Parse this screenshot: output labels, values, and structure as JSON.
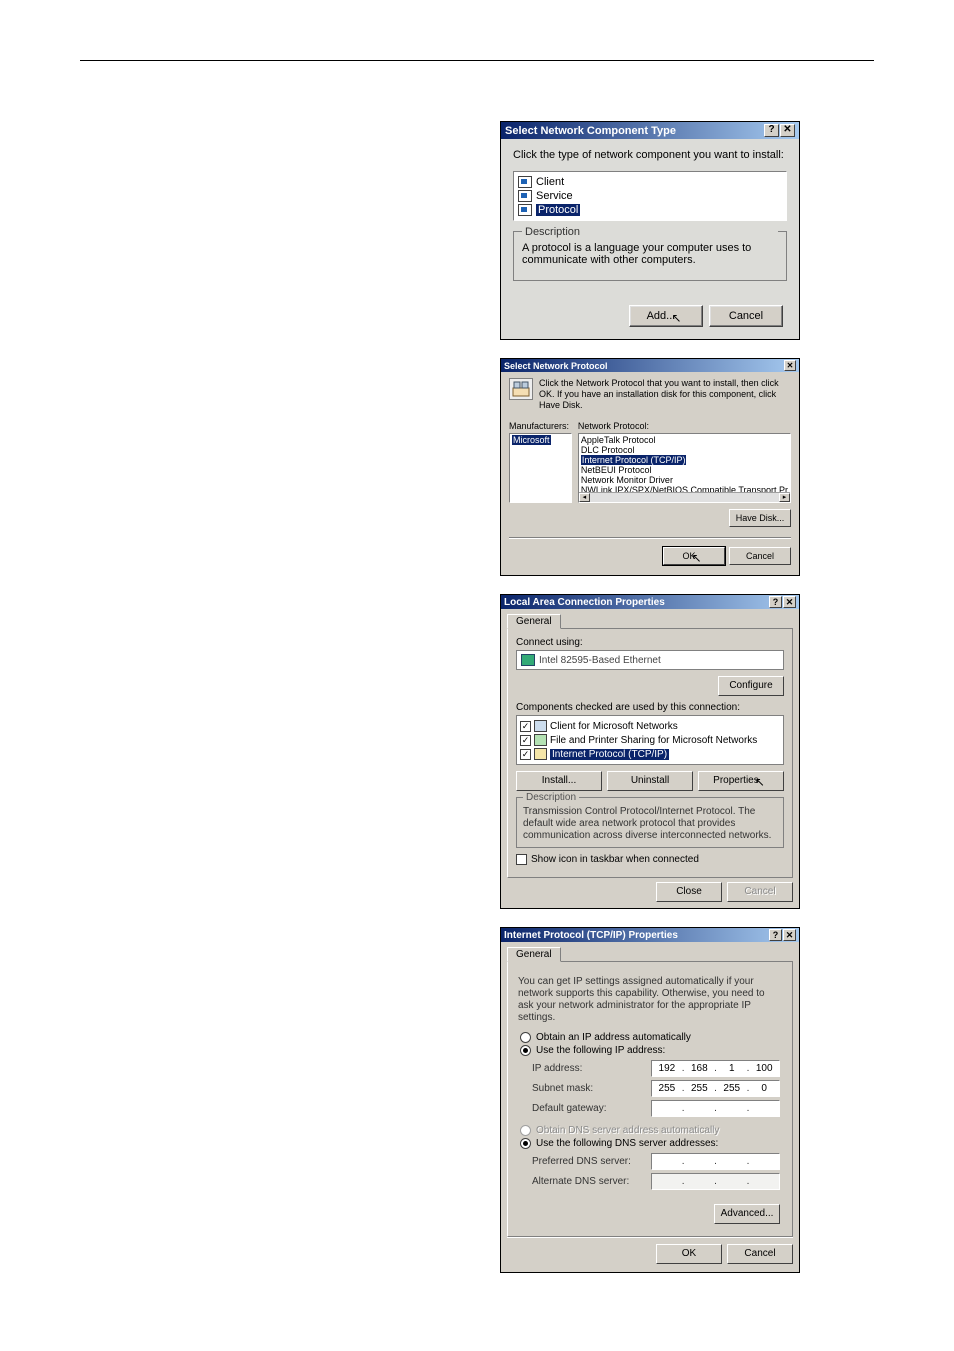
{
  "dlg1": {
    "title": "Select Network Component Type",
    "instruction": "Click the type of network component you want to install:",
    "items": {
      "client": "Client",
      "service": "Service",
      "protocol": "Protocol"
    },
    "desc_label": "Description",
    "desc_text": "A protocol is a language your computer uses to communicate with other computers.",
    "add": "Add...",
    "cancel": "Cancel"
  },
  "dlg2": {
    "title": "Select Network Protocol",
    "instruction": "Click the Network Protocol that you want to install, then click OK. If you have an installation disk for this component, click Have Disk.",
    "mfr_label": "Manufacturers:",
    "mfr_item": "Microsoft",
    "proto_label": "Network Protocol:",
    "protocols": {
      "p0": "AppleTalk Protocol",
      "p1": "DLC Protocol",
      "p2": "Internet Protocol (TCP/IP)",
      "p3": "NetBEUI Protocol",
      "p4": "Network Monitor Driver",
      "p5": "NWLink IPX/SPX/NetBIOS Compatible Transport Pr"
    },
    "have_disk": "Have Disk...",
    "ok": "OK",
    "cancel": "Cancel"
  },
  "dlg3": {
    "title": "Local Area Connection Properties",
    "tab": "General",
    "connect_label": "Connect using:",
    "adapter": "Intel 82595-Based Ethernet",
    "configure": "Configure",
    "components_label": "Components checked are used by this connection:",
    "c0": "Client for Microsoft Networks",
    "c1": "File and Printer Sharing for Microsoft Networks",
    "c2": "Internet Protocol (TCP/IP)",
    "install": "Install...",
    "uninstall": "Uninstall",
    "properties": "Properties",
    "desc_label": "Description",
    "desc_text": "Transmission Control Protocol/Internet Protocol. The default wide area network protocol that provides communication across diverse interconnected networks.",
    "show_icon": "Show icon in taskbar when connected",
    "close": "Close",
    "cancel": "Cancel"
  },
  "dlg4": {
    "title": "Internet Protocol (TCP/IP) Properties",
    "tab": "General",
    "intro": "You can get IP settings assigned automatically if your network supports this capability. Otherwise, you need to ask your network administrator for the appropriate IP settings.",
    "obtain_ip": "Obtain an IP address automatically",
    "use_ip": "Use the following IP address:",
    "ip_label": "IP address:",
    "ip_v": {
      "a": "192",
      "b": "168",
      "c": "1",
      "d": "100"
    },
    "mask_label": "Subnet mask:",
    "mask_v": {
      "a": "255",
      "b": "255",
      "c": "255",
      "d": "0"
    },
    "gw_label": "Default gateway:",
    "obtain_dns": "Obtain DNS server address automatically",
    "use_dns": "Use the following DNS server addresses:",
    "pref_dns": "Preferred DNS server:",
    "alt_dns": "Alternate DNS server:",
    "advanced": "Advanced...",
    "ok": "OK",
    "cancel": "Cancel"
  }
}
